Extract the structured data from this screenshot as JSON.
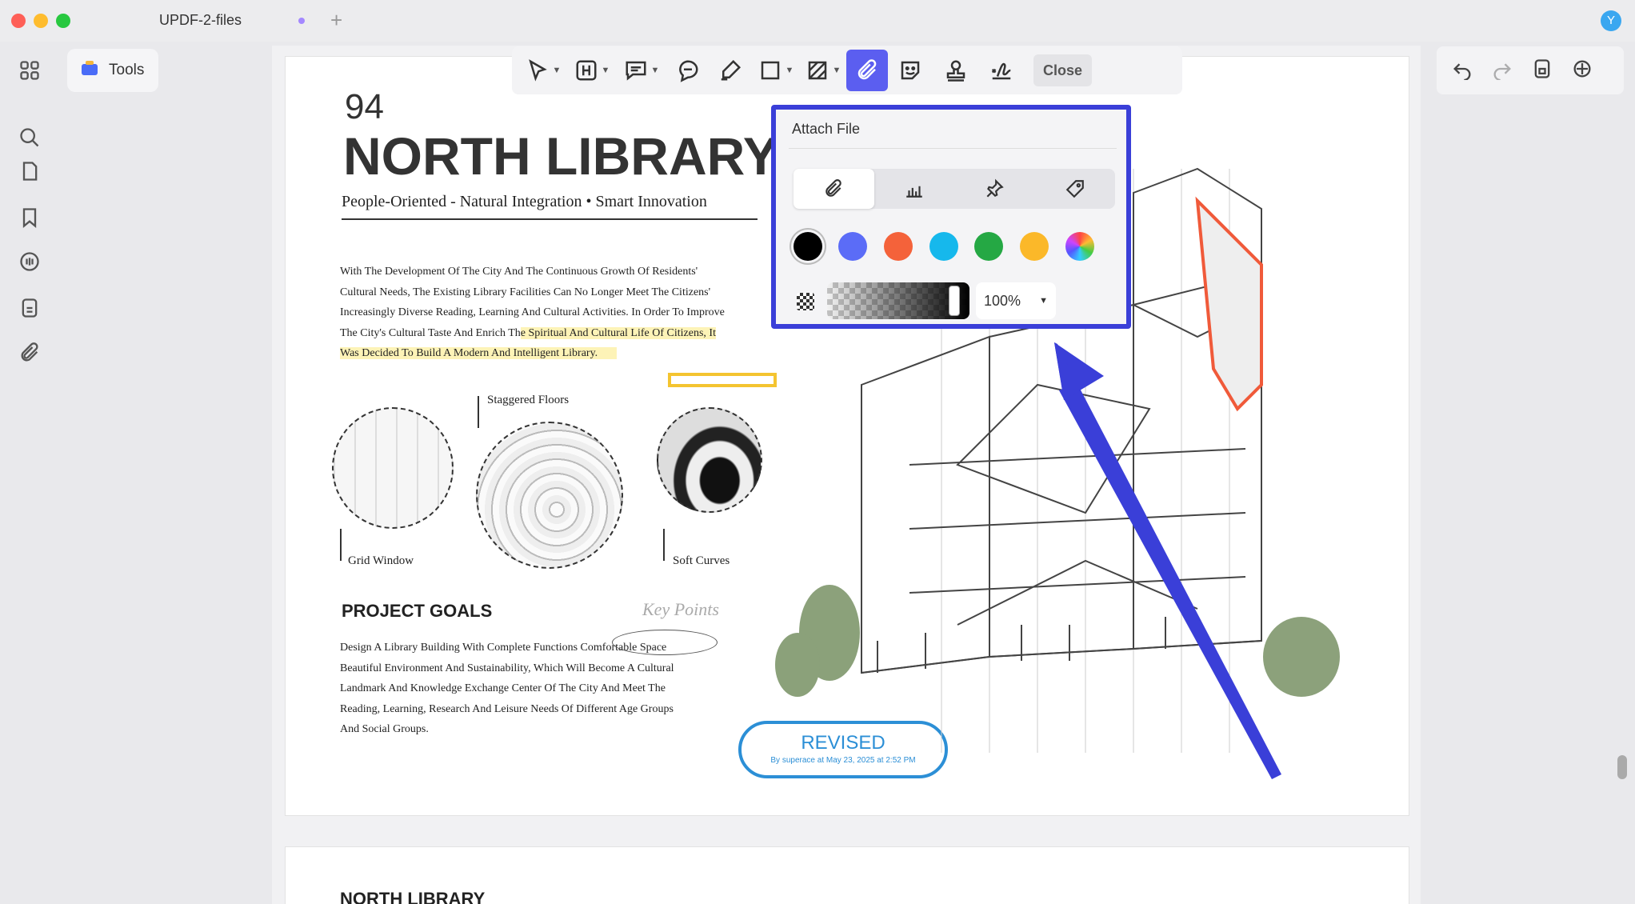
{
  "window": {
    "title": "UPDF-2-files",
    "avatar_initial": "Y"
  },
  "colors": {
    "accent": "#5b5ef0",
    "popup_border": "#3a3fd8",
    "arrow": "#3a3fd8"
  },
  "sidebar": {
    "icons": [
      "grid-icon",
      "search-icon",
      "pages-icon",
      "bookmark-icon",
      "comment-icon",
      "form-icon",
      "attachment-icon"
    ]
  },
  "tools_button": {
    "label": "Tools"
  },
  "toolbar": {
    "items": [
      "select-tool",
      "heading-tool",
      "comment-tool",
      "text-comment-tool",
      "highlighter-tool",
      "rectangle-tool",
      "hatch-tool",
      "attach-tool",
      "sticker-tool",
      "stamp-tool",
      "signature-tool"
    ],
    "close_label": "Close"
  },
  "popup": {
    "title": "Attach File",
    "tabs": [
      "paperclip-icon",
      "graph-icon",
      "pushpin-icon",
      "tag-icon"
    ],
    "colors": [
      "#000000",
      "#5b6cf7",
      "#f4623a",
      "#16b8ec",
      "#25a844",
      "#fbb829",
      "rainbow"
    ],
    "opacity": "100%",
    "opacity_value": 1.0
  },
  "document": {
    "page_number": "94",
    "title": "NORTH LIBRARY",
    "subtitle": "People-Oriented - Natural Integration • Smart Innovation",
    "intro_lines": [
      "With The Development Of The City And The Continuous Growth Of Residents'",
      "Cultural Needs, The Existing Library Facilities Can No Longer Meet The Citizens'",
      "Increasingly Diverse Reading, Learning And Cultural Activities. In Order To Improve",
      "The City's Cultural Taste And Enrich Th",
      "e Spiritual And Cultural Life Of Citizens, It",
      "Was Decided To Build A Modern And Intelligent Library."
    ],
    "captions": {
      "staggered": "Staggered Floors",
      "grid": "Grid Window",
      "soft": "Soft Curves"
    },
    "goals_heading": "PROJECT GOALS",
    "key_points": "Key Points",
    "goals_lines": [
      "Design A Library Building With Complete Functions Comfortable Space",
      "Beautiful Environment And Sustainability, Which Will Become A Cultural",
      "Landmark And Knowledge Exchange Center Of The City And Meet The",
      "Reading, Learning, Research And Leisure Needs Of Different Age Groups",
      "And Social Groups."
    ],
    "stamp": {
      "title": "REVISED",
      "subtitle": "By superace at May 23, 2025 at 2:52 PM"
    },
    "page2_title": "NORTH LIBRARY"
  }
}
